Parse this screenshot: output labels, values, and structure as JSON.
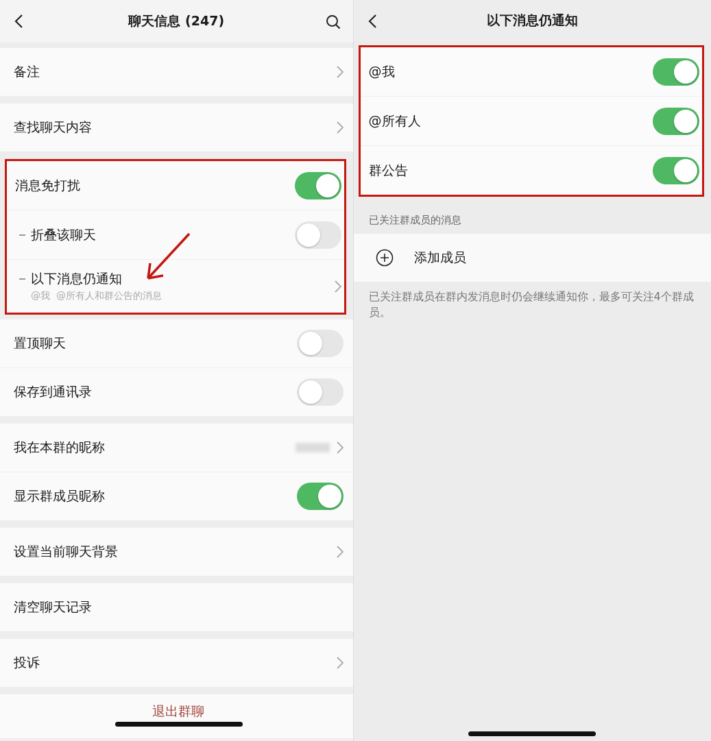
{
  "left_screen": {
    "title": "聊天信息 (247)",
    "sections": [
      {
        "highlighted": false,
        "rows": [
          {
            "kind": "link",
            "label": "备注"
          }
        ]
      },
      {
        "highlighted": false,
        "rows": [
          {
            "kind": "link",
            "label": "查找聊天内容"
          }
        ]
      },
      {
        "highlighted": true,
        "rows": [
          {
            "kind": "toggle",
            "label": "消息免打扰",
            "on": true
          },
          {
            "kind": "sub_toggle",
            "label": "折叠该聊天",
            "on": false
          },
          {
            "kind": "sub_link",
            "label": "以下消息仍通知",
            "detail": "@我  @所有人和群公告的消息"
          }
        ]
      },
      {
        "highlighted": false,
        "rows": [
          {
            "kind": "toggle",
            "label": "置顶聊天",
            "on": false
          },
          {
            "kind": "toggle",
            "label": "保存到通讯录",
            "on": false
          }
        ]
      },
      {
        "highlighted": false,
        "rows": [
          {
            "kind": "nickname",
            "label": "我在本群的昵称"
          },
          {
            "kind": "toggle",
            "label": "显示群成员昵称",
            "on": true
          }
        ]
      },
      {
        "highlighted": false,
        "rows": [
          {
            "kind": "link",
            "label": "设置当前聊天背景"
          }
        ]
      },
      {
        "highlighted": false,
        "rows": [
          {
            "kind": "plain",
            "label": "清空聊天记录"
          }
        ]
      },
      {
        "highlighted": false,
        "rows": [
          {
            "kind": "link",
            "label": "投诉"
          }
        ]
      },
      {
        "highlighted": false,
        "rows": [
          {
            "kind": "danger",
            "label": "退出群聊"
          }
        ]
      }
    ]
  },
  "right_screen": {
    "title": "以下消息仍通知",
    "toggles": [
      {
        "label": "@我",
        "on": true
      },
      {
        "label": "@所有人",
        "on": true
      },
      {
        "label": "群公告",
        "on": true
      }
    ],
    "section_label": "已关注群成员的消息",
    "add_member": "添加成员",
    "note": "已关注群成员在群内发消息时仍会继续通知你，最多可关注4个群成员。"
  }
}
